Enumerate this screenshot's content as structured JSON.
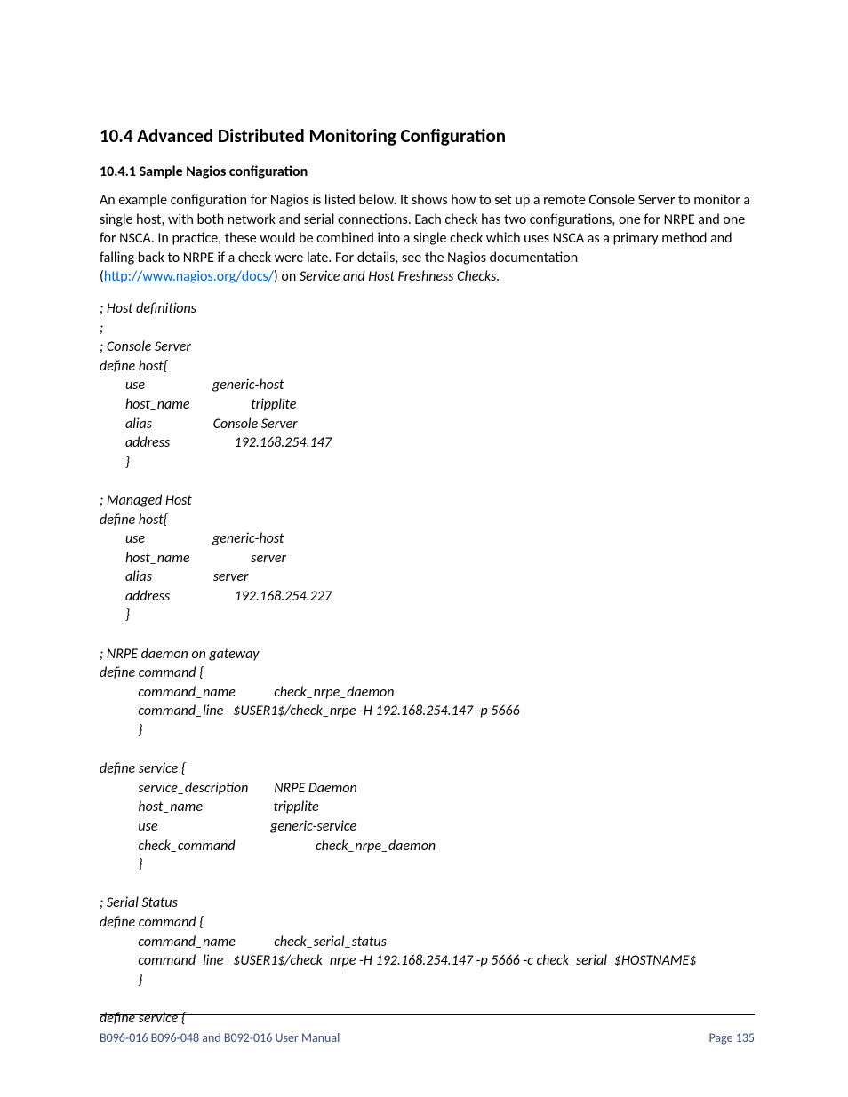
{
  "heading_section": "10.4   Advanced Distributed Monitoring Configuration",
  "heading_sub": "10.4.1   Sample Nagios configuration",
  "intro_parts": {
    "a": "An example configuration for Nagios is listed below. It shows how to set up a remote Console Server to monitor a single host, with both network and serial connections. Each check has two configurations, one for NRPE and one for NSCA. In practice, these would be combined into a single check which uses NSCA as a primary method and falling back to NRPE if a check were late. For details, see the Nagios documentation (",
    "link_text": "http://www.nagios.org/docs/",
    "b": ") on ",
    "ital": "Service and Host Freshness Checks.",
    "link_href": "http://www.nagios.org/docs/"
  },
  "code_block": "; Host definitions\n;\n; Console Server\ndefine host{\n        use                     generic-host\n        host_name                   tripplite\n        alias                   Console Server\n        address                    192.168.254.147\n        }\n\n; Managed Host\ndefine host{\n        use                     generic-host\n        host_name                   server\n        alias                   server\n        address                    192.168.254.227\n        }\n\n; NRPE daemon on gateway\ndefine command {\n            command_name            check_nrpe_daemon\n            command_line   $USER1$/check_nrpe -H 192.168.254.147 -p 5666\n            }\n\ndefine service {\n            service_description        NRPE Daemon\n            host_name                      tripplite\n            use                                   generic-service\n            check_command                         check_nrpe_daemon\n            }\n\n; Serial Status\ndefine command {\n            command_name            check_serial_status\n            command_line   $USER1$/check_nrpe -H 192.168.254.147 -p 5666 -c check_serial_$HOSTNAME$\n            }\n\ndefine service {",
  "footer": {
    "left": "B096-016 B096-048 and B092-016 User Manual",
    "right": "Page 135"
  }
}
